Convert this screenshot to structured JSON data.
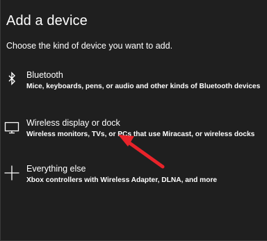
{
  "dialog": {
    "title": "Add a device",
    "subtitle": "Choose the kind of device you want to add."
  },
  "options": [
    {
      "icon": "bluetooth-icon",
      "label": "Bluetooth",
      "description": "Mice, keyboards, pens, or audio and other kinds of Bluetooth devices"
    },
    {
      "icon": "monitor-icon",
      "label": "Wireless display or dock",
      "description": "Wireless monitors, TVs, or PCs that use Miracast, or wireless docks"
    },
    {
      "icon": "plus-icon",
      "label": "Everything else",
      "description": "Xbox controllers with Wireless Adapter, DLNA, and more"
    }
  ],
  "colors": {
    "background": "#1f1f1f",
    "text": "#ffffff",
    "annotation_arrow": "#e8232a"
  }
}
